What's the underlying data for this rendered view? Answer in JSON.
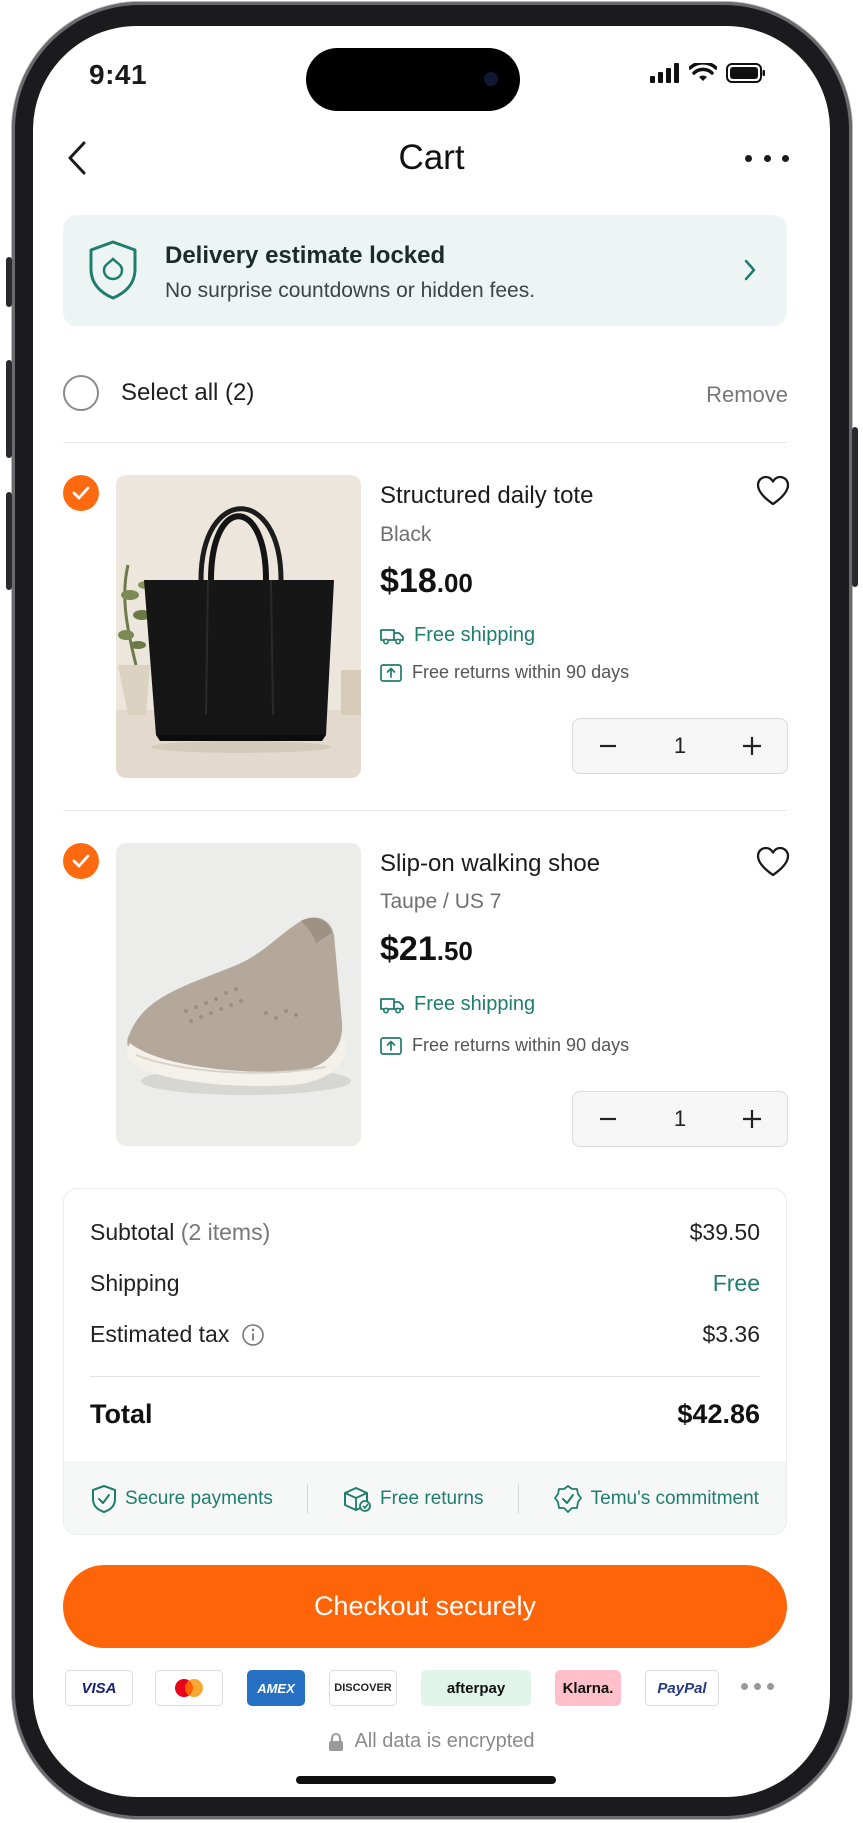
{
  "status_bar": {
    "time": "9:41"
  },
  "header": {
    "title": "Cart"
  },
  "banner": {
    "title": "Delivery estimate locked",
    "subtitle": "No surprise countdowns or hidden fees."
  },
  "select_all": {
    "label": "Select all (2)",
    "remove": "Remove"
  },
  "items": [
    {
      "name": "Structured daily tote",
      "variant": "Black",
      "price_whole": "$18",
      "price_cents": ".00",
      "shipping": "Free shipping",
      "returns": "Free returns within 90 days",
      "quantity": "1",
      "selected": true
    },
    {
      "name": "Slip-on walking shoe",
      "variant": "Taupe / US 7",
      "price_whole": "$21",
      "price_cents": ".50",
      "shipping": "Free shipping",
      "returns": "Free returns within 90 days",
      "quantity": "1",
      "selected": true
    }
  ],
  "summary": {
    "subtotal_label": "Subtotal",
    "subtotal_count": "(2 items)",
    "subtotal_value": "$39.50",
    "shipping_label": "Shipping",
    "shipping_value": "Free",
    "tax_label": "Estimated tax",
    "tax_value": "$3.36",
    "total_label": "Total",
    "total_value": "$42.86"
  },
  "trust": {
    "secure": "Secure payments",
    "returns": "Free returns",
    "commitment": "Temu's commitment"
  },
  "checkout": {
    "label": "Checkout securely"
  },
  "payment_methods": [
    "VISA",
    "Mastercard",
    "AMEX",
    "DISCOVER",
    "afterpay",
    "Klarna.",
    "PayPal"
  ],
  "footer": {
    "encrypted": "All data is encrypted"
  },
  "colors": {
    "accent": "#ff6508",
    "green": "#1f7d6c",
    "banner_bg": "#ecf5f4"
  }
}
